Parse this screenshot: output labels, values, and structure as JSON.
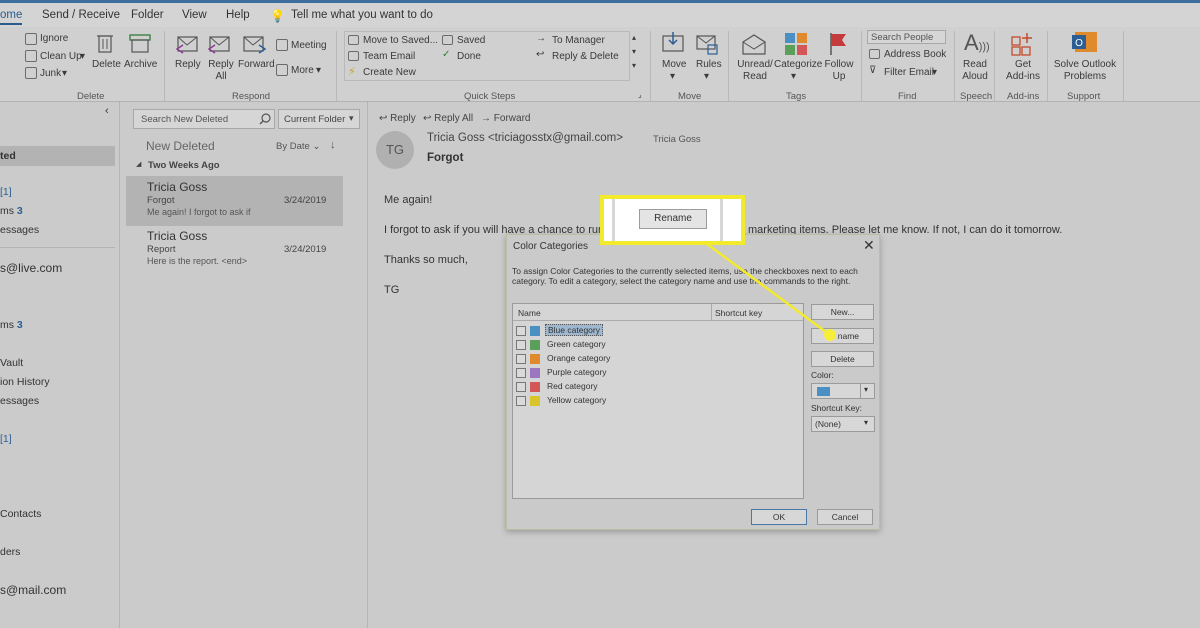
{
  "menu": {
    "items": [
      "ome",
      "Send / Receive",
      "Folder",
      "View",
      "Help"
    ],
    "tell_me": "Tell me what you want to do"
  },
  "ribbon": {
    "delete_group": {
      "ignore": "Ignore",
      "clean_up": "Clean Up",
      "junk": "Junk",
      "delete": "Delete",
      "archive": "Archive",
      "group_label": "Delete"
    },
    "respond_group": {
      "reply": "Reply",
      "reply_all": "Reply All",
      "forward": "Forward",
      "meeting": "Meeting",
      "more": "More",
      "group_label": "Respond"
    },
    "quick_steps": {
      "move_to_saved": "Move to Saved...",
      "team_email": "Team Email",
      "create_new": "Create New",
      "saved": "Saved",
      "done": "Done",
      "to_manager": "To Manager",
      "reply_delete": "Reply & Delete",
      "group_label": "Quick Steps"
    },
    "move_group": {
      "move": "Move",
      "rules": "Rules",
      "group_label": "Move"
    },
    "tags_group": {
      "unread_read": "Unread/ Read",
      "categorize": "Categorize",
      "follow_up": "Follow Up",
      "group_label": "Tags"
    },
    "find_group": {
      "search_people_placeholder": "Search People",
      "address_book": "Address Book",
      "filter_email": "Filter Email",
      "group_label": "Find"
    },
    "speech_group": {
      "read_aloud": "Read Aloud",
      "group_label": "Speech"
    },
    "addins_group": {
      "get_addins": "Get Add-ins",
      "group_label": "Add-ins"
    },
    "support_group": {
      "solve": "Solve Outlook Problems",
      "group_label": "Support"
    }
  },
  "nav": {
    "items": [
      {
        "label": "ted",
        "selected": true
      },
      {
        "label": "[1]"
      },
      {
        "label": "ms",
        "count": "3"
      },
      {
        "label": "essages"
      },
      {
        "label": "s@live.com",
        "big": true
      },
      {
        "label": "ms",
        "count": "3"
      },
      {
        "label": "Vault"
      },
      {
        "label": "ion History"
      },
      {
        "label": "essages"
      },
      {
        "label": "[1]"
      },
      {
        "label": " Contacts"
      },
      {
        "label": "ders"
      },
      {
        "label": "s@mail.com",
        "big": true
      }
    ]
  },
  "message_list": {
    "search_placeholder": "Search New Deleted",
    "scope": "Current Folder",
    "folder_title": "New Deleted",
    "sort": "By Date",
    "group_header": "Two Weeks Ago",
    "messages": [
      {
        "from": "Tricia Goss",
        "subject": "Forgot",
        "preview": "Me again!  I forgot to ask if",
        "date": "3/24/2019",
        "selected": true
      },
      {
        "from": "Tricia Goss",
        "subject": "Report",
        "preview": "Here is the report. <end>",
        "date": "3/24/2019",
        "selected": false
      }
    ]
  },
  "reading_pane": {
    "actions": {
      "reply": "Reply",
      "reply_all": "Reply All",
      "forward": "Forward"
    },
    "initials": "TG",
    "sender": "Tricia Goss <triciagosstx@gmail.com>",
    "to": "Tricia Goss",
    "subject": "Forgot",
    "body": [
      "Me again!",
      "I forgot to ask if you will have a chance to run",
      "marketing items. Please let me know. If not, I can do it tomorrow.",
      "Thanks so much,",
      "TG"
    ]
  },
  "callout": {
    "button_label": "Rename",
    "highlight_color": "#f2ea2c"
  },
  "dialog": {
    "title": "Color Categories",
    "close_glyph": "✕",
    "instructions": "To assign Color Categories to the currently selected items, use the checkboxes next to each category.  To edit a category, select the category name and use the commands to the right.",
    "col_name": "Name",
    "col_shortcut": "Shortcut key",
    "categories": [
      {
        "name": "Blue category",
        "color": "#4a90c2",
        "highlighted": true
      },
      {
        "name": "Green category",
        "color": "#5aa05a"
      },
      {
        "name": "Orange category",
        "color": "#e08a2e"
      },
      {
        "name": "Purple category",
        "color": "#9a77c0"
      },
      {
        "name": "Red category",
        "color": "#d45757"
      },
      {
        "name": "Yellow category",
        "color": "#d9c52a"
      }
    ],
    "new_label": "New...",
    "rename_label": "name",
    "delete_label": "Delete",
    "color_label": "Color:",
    "color_value": "#4a90c2",
    "shortcut_label": "Shortcut Key:",
    "shortcut_value": "(None)",
    "ok_label": "OK",
    "cancel_label": "Cancel"
  }
}
